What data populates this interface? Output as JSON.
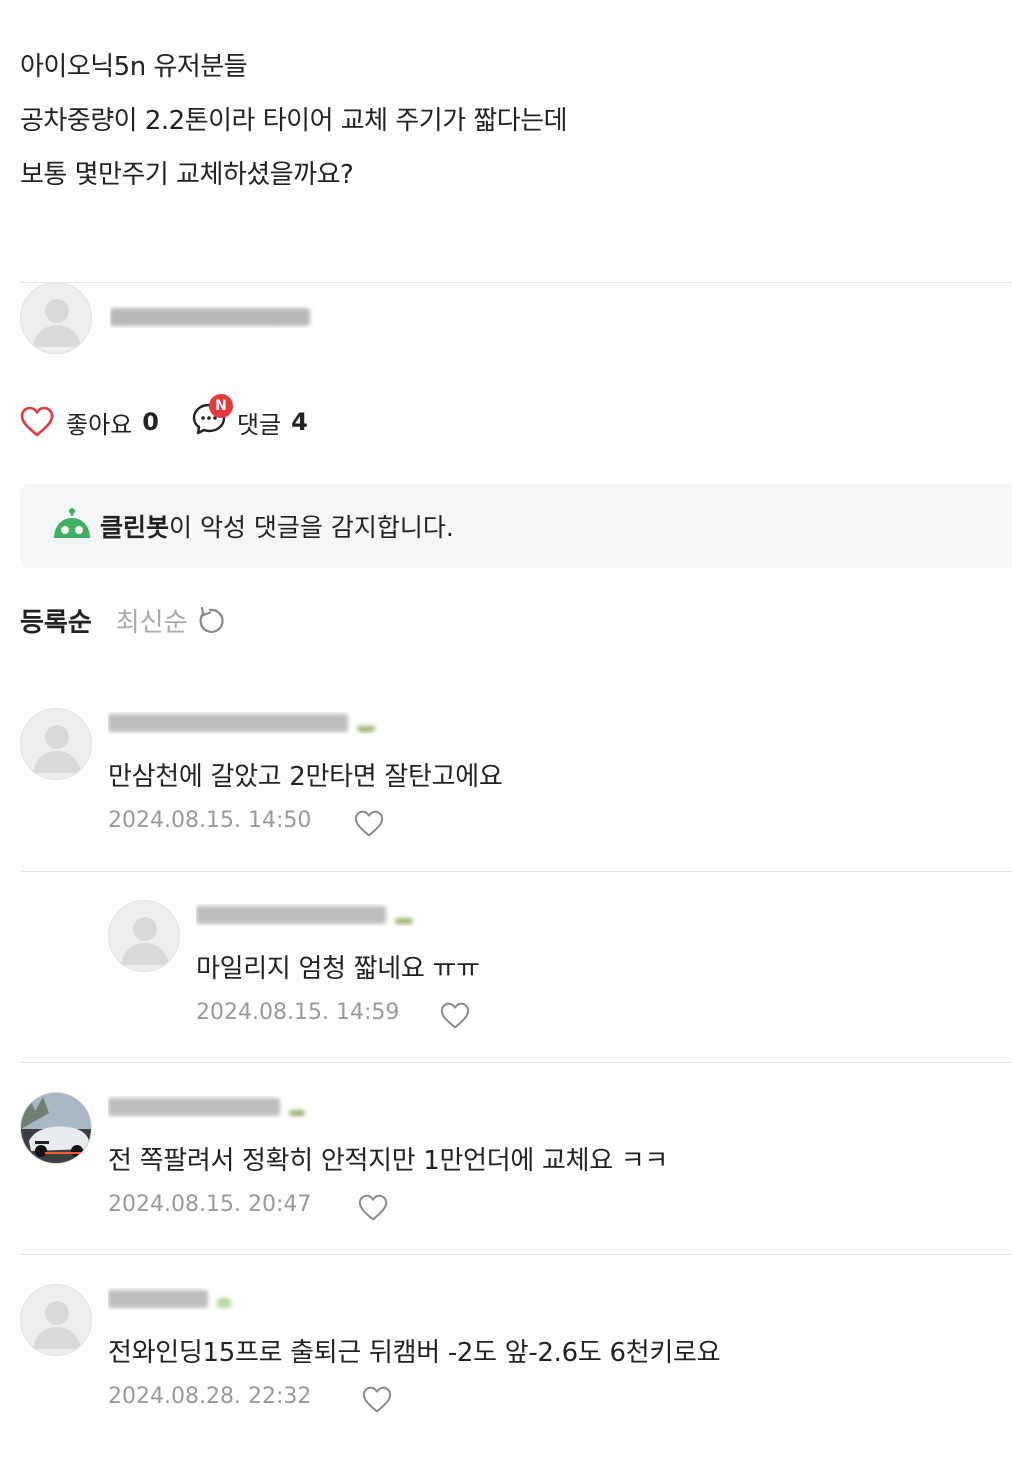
{
  "post": {
    "lines": [
      "아이오닉5n 유저분들",
      "공차중량이 2.2톤이라 타이어 교체 주기가 짧다는데",
      "보통 몇만주기 교체하셨을까요?"
    ]
  },
  "actions": {
    "like_label": "좋아요",
    "like_count": "0",
    "comment_label": "댓글",
    "comment_count": "4",
    "new_badge": "N"
  },
  "cleanbot": {
    "name": "클린봇",
    "message": "이 악성 댓글을 감지합니다."
  },
  "sort": {
    "active": "등록순",
    "inactive": "최신순"
  },
  "comments": [
    {
      "text": "만삼천에 갈았고 2만타면 잘탄고에요",
      "date": "2024.08.15. 14:50"
    },
    {
      "text": "마일리지 엄청 짧네요 ㅠㅠ",
      "date": "2024.08.15. 14:59"
    },
    {
      "text": "전 쪽팔려서 정확히 안적지만 1만언더에 교체요 ㅋㅋ",
      "date": "2024.08.15. 20:47"
    },
    {
      "text": "전와인딩15프로 출퇴근 뒤캠버 -2도 앞-2.6도 6천키로요",
      "date": "2024.08.28. 22:32"
    }
  ],
  "colors": {
    "heart_red": "#e5393c",
    "cleanbot_green": "#3fb15f",
    "badge_red": "#e5393c",
    "muted": "#999999"
  }
}
